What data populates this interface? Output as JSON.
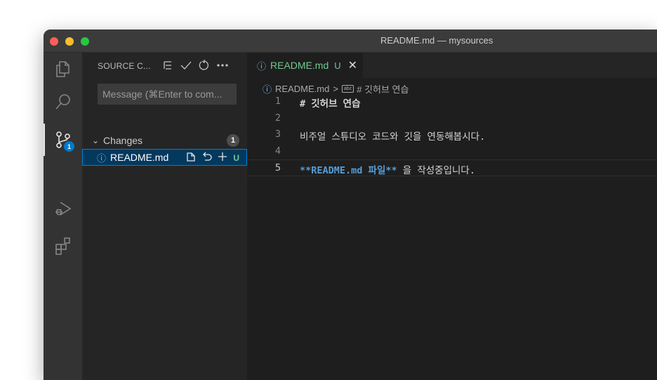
{
  "window": {
    "title": "README.md — mysources"
  },
  "activity_bar": {
    "items": [
      "explorer-icon",
      "search-icon",
      "source-control-icon",
      "run-debug-icon",
      "extensions-icon"
    ],
    "scm_badge": "1"
  },
  "sidebar": {
    "header": "SOURCE C...",
    "actions": [
      "tree-view-icon",
      "commit-check-icon",
      "refresh-icon",
      "more-icon"
    ],
    "message_placeholder": "Message (⌘Enter to com...",
    "changes_label": "Changes",
    "changes_count": "1",
    "file": {
      "name": "README.md",
      "status": "U"
    }
  },
  "editor": {
    "tab": {
      "name": "README.md",
      "status": "U"
    },
    "breadcrumb": {
      "file": "README.md",
      "sep": ">",
      "symbol": "# 깃허브 연습"
    },
    "lines": [
      {
        "n": "1",
        "text": "# 깃허브 연습"
      },
      {
        "n": "2",
        "text": ""
      },
      {
        "n": "3",
        "text": "비주얼 스튜디오 코드와 깃을 연동해봅시다."
      },
      {
        "n": "4",
        "text": ""
      },
      {
        "n": "5",
        "bold": "**README.md 파일**",
        "rest": " 을 작성중입니다."
      }
    ]
  }
}
